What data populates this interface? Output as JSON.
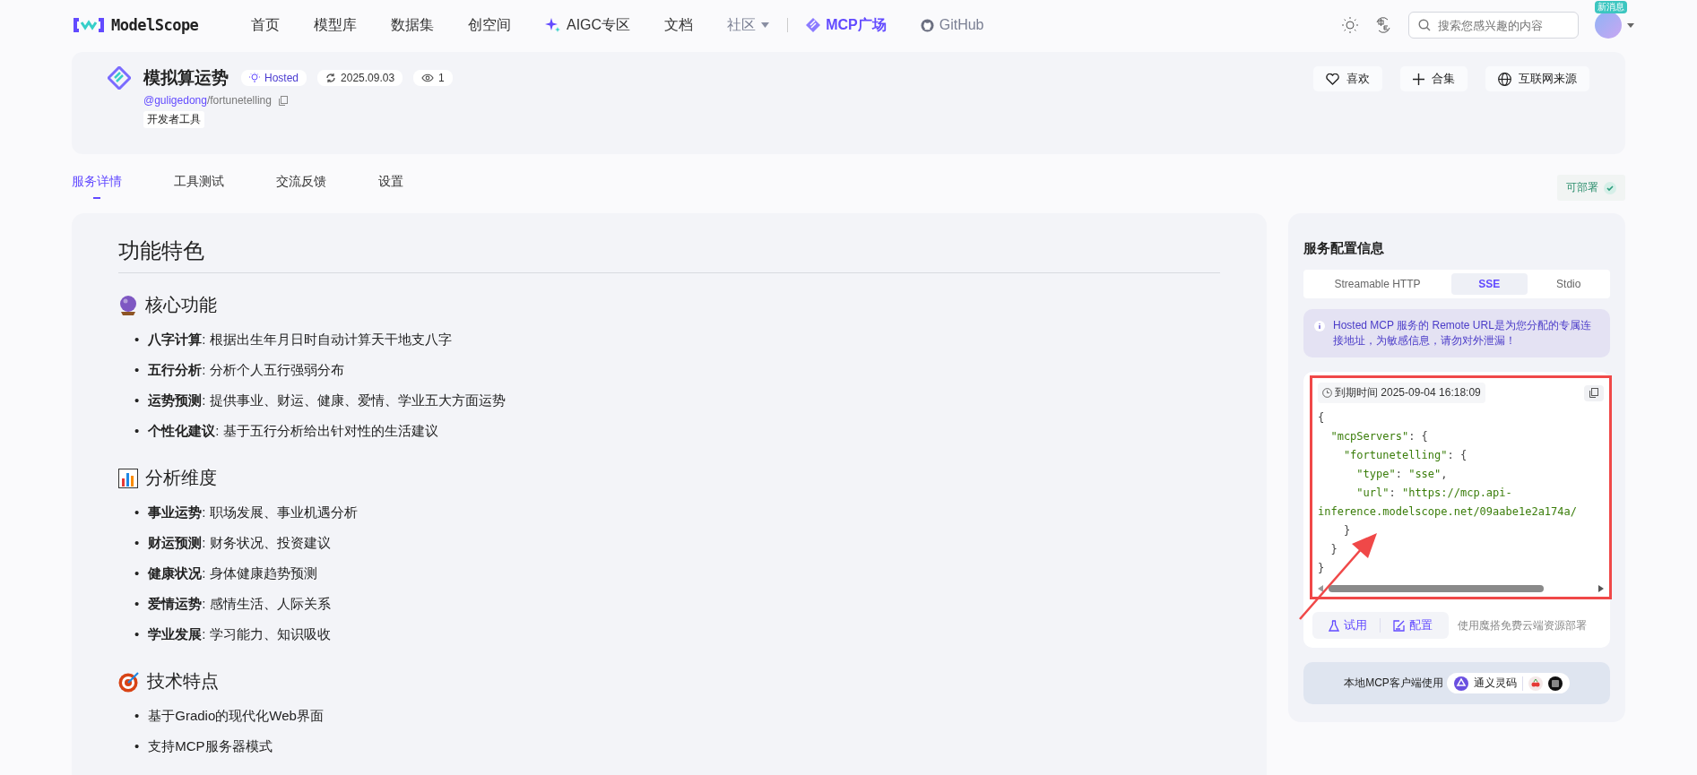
{
  "nav": {
    "logo": "ModelScope",
    "items": [
      {
        "label": "首页",
        "kind": "plain",
        "selected": false
      },
      {
        "label": "模型库",
        "kind": "plain",
        "selected": false
      },
      {
        "label": "数据集",
        "kind": "plain",
        "selected": false
      },
      {
        "label": "创空间",
        "kind": "plain",
        "selected": false
      },
      {
        "label": "AIGC专区",
        "kind": "sparkle",
        "selected": false
      },
      {
        "label": "文档",
        "kind": "plain",
        "selected": false
      },
      {
        "label": "社区",
        "kind": "dropdown",
        "selected": false
      },
      {
        "label": "MCP广场",
        "kind": "mcp",
        "selected": true
      },
      {
        "label": "GitHub",
        "kind": "github",
        "selected": false
      }
    ],
    "search": {
      "placeholder": "搜索您感兴趣的内容"
    },
    "badge": "新消息"
  },
  "header": {
    "title": "模拟算运势",
    "badges": [
      {
        "kind": "hosted",
        "text": "Hosted"
      },
      {
        "kind": "date",
        "text": "2025.09.03"
      },
      {
        "kind": "views",
        "text": "1"
      }
    ],
    "owner": "@guligedong",
    "repo": "/fortunetelling",
    "tag": "开发者工具",
    "actions": [
      {
        "kind": "like",
        "label": "喜欢"
      },
      {
        "kind": "add",
        "label": "合集"
      },
      {
        "kind": "globe",
        "label": "互联网来源"
      }
    ]
  },
  "tabs": [
    {
      "label": "服务详情",
      "selected": true
    },
    {
      "label": "工具测试",
      "selected": false
    },
    {
      "label": "交流反馈",
      "selected": false
    },
    {
      "label": "设置",
      "selected": false
    }
  ],
  "deploy_status": "可部署",
  "readme": {
    "title": "功能特色",
    "sections": [
      {
        "kind": "orb",
        "title": "核心功能",
        "items": [
          {
            "marker": "•",
            "bold": "八字计算",
            "text": ": 根据出生年月日时自动计算天干地支八字"
          },
          {
            "marker": "•",
            "bold": "五行分析",
            "text": ": 分析个人五行强弱分布"
          },
          {
            "marker": "•",
            "bold": "运势预测",
            "text": ": 提供事业、财运、健康、爱情、学业五大方面运势"
          },
          {
            "marker": "•",
            "bold": "个性化建议",
            "text": ": 基于五行分析给出针对性的生活建议"
          }
        ]
      },
      {
        "kind": "chart",
        "title": "分析维度",
        "items": [
          {
            "marker": "•",
            "bold": "事业运势",
            "text": ": 职场发展、事业机遇分析"
          },
          {
            "marker": "•",
            "bold": "财运预测",
            "text": ": 财务状况、投资建议"
          },
          {
            "marker": "•",
            "bold": "健康状况",
            "text": ": 身体健康趋势预测"
          },
          {
            "marker": "•",
            "bold": "爱情运势",
            "text": ": 感情生活、人际关系"
          },
          {
            "marker": "•",
            "bold": "学业发展",
            "text": ": 学习能力、知识吸收"
          }
        ]
      },
      {
        "kind": "target",
        "title": "技术特点",
        "items": [
          {
            "marker": "•",
            "text": "基于Gradio的现代化Web界面"
          },
          {
            "marker": "•",
            "text": "支持MCP服务器模式"
          }
        ]
      }
    ]
  },
  "config": {
    "title": "服务配置信息",
    "transports": [
      {
        "label": "Streamable HTTP",
        "selected": false
      },
      {
        "label": "SSE",
        "selected": true
      },
      {
        "label": "Stdio",
        "selected": false
      }
    ],
    "notice": "Hosted MCP 服务的 Remote URL是为您分配的专属连接地址，为敏感信息，请勿对外泄漏！",
    "expiry": "到期时间 2025-09-04 16:18:09",
    "code": [
      [
        {
          "kind": "punct",
          "text": "{"
        }
      ],
      [
        {
          "kind": "str",
          "text": "  \"mcpServers\""
        },
        {
          "kind": "punct",
          "text": ": {"
        }
      ],
      [
        {
          "kind": "str",
          "text": "    \"fortunetelling\""
        },
        {
          "kind": "punct",
          "text": ": {"
        }
      ],
      [
        {
          "kind": "str",
          "text": "      \"type\""
        },
        {
          "kind": "punct",
          "text": ": "
        },
        {
          "kind": "str",
          "text": "\"sse\""
        },
        {
          "kind": "punct",
          "text": ","
        }
      ],
      [
        {
          "kind": "str",
          "text": "      \"url\""
        },
        {
          "kind": "punct",
          "text": ": "
        },
        {
          "kind": "str",
          "text": "\"https://mcp.api-"
        }
      ],
      [
        {
          "kind": "str",
          "text": "inference.modelscope.net/09aabe1e2a174a/"
        }
      ],
      [
        {
          "kind": "punct",
          "text": "    }"
        }
      ],
      [
        {
          "kind": "punct",
          "text": "  }"
        }
      ],
      [
        {
          "kind": "punct",
          "text": "}"
        }
      ]
    ],
    "buttons": [
      {
        "kind": "flask",
        "label": "试用"
      },
      {
        "kind": "edit",
        "label": "配置"
      }
    ],
    "deploy_hint": "使用魔搭免费云端资源部署",
    "local_label": "本地MCP客户端使用",
    "client": "通义灵码"
  }
}
